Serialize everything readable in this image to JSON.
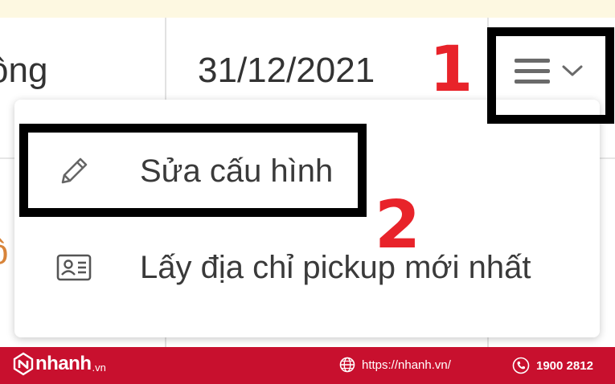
{
  "table": {
    "status_cell": "ộng",
    "status_cell_2": "ộ",
    "date_cell": "31/12/2021"
  },
  "menu_toggle": {
    "icons": [
      "menu-icon",
      "chevron-down-icon"
    ]
  },
  "dropdown": {
    "items": [
      {
        "label": "Sửa cấu hình",
        "icon": "pencil-icon"
      },
      {
        "label": "Lấy địa chỉ pickup mới nhất",
        "icon": "id-card-icon"
      }
    ]
  },
  "annotations": {
    "step1": "1",
    "step2": "2",
    "color": "#e8232a"
  },
  "footer": {
    "brand": "nhanh",
    "brand_tld": ".vn",
    "website": "https://nhanh.vn/",
    "phone": "1900 2812",
    "background": "#c8102e"
  }
}
